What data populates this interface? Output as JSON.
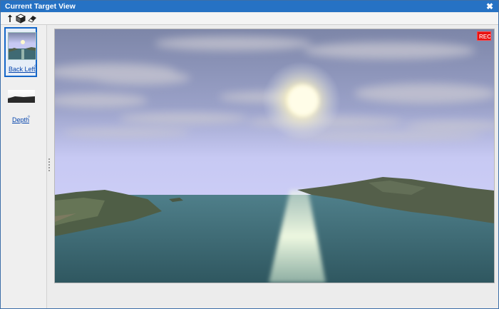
{
  "window": {
    "title": "Current Target View"
  },
  "toolbar": {
    "tools": [
      "pointer-tool-icon",
      "cube-view-icon",
      "eraser-tool-icon"
    ]
  },
  "sidebar": {
    "targets": [
      {
        "label": "Back Left",
        "icon": "external-link-icon",
        "selected": true
      },
      {
        "label": "Depth",
        "icon": "external-link-icon",
        "selected": false
      }
    ]
  },
  "viewport": {
    "overlay_icon": "record-indicator-icon",
    "colors": {
      "sky_top": "#7d86a8",
      "horizon": "#c7c9f3",
      "sea": "#3f6a73",
      "sun": "#fff9cf"
    }
  },
  "theme": {
    "title_bar": "#2672c4",
    "selection": "#1466c8",
    "link": "#0645ad",
    "record": "#e81010"
  }
}
